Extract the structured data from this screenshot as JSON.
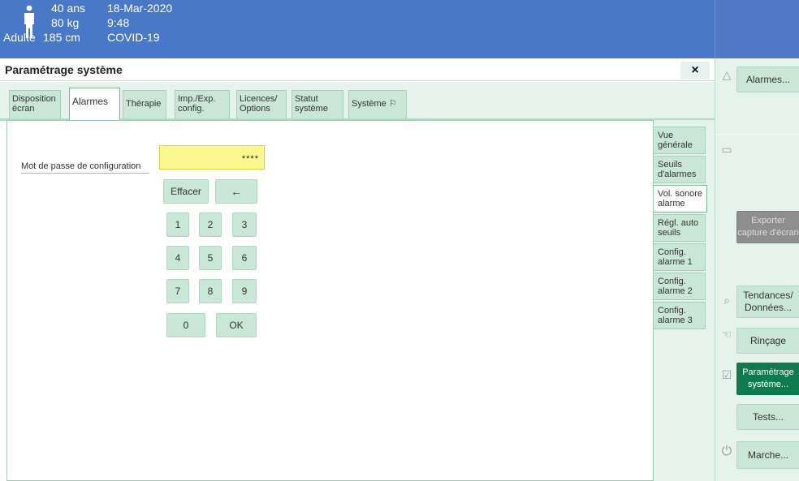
{
  "patient": {
    "age": "40 ans",
    "weight": "80 kg",
    "category": "Adulte",
    "height": "185 cm",
    "date": "18-Mar-2020",
    "time": "9:48",
    "diagnosis": "COVID-19"
  },
  "window": {
    "title": "Paramétrage système",
    "close_label": "×"
  },
  "tabs": [
    {
      "label": "Disposition écran"
    },
    {
      "label": "Alarmes"
    },
    {
      "label": "Thérapie"
    },
    {
      "label": "Imp./Exp. config."
    },
    {
      "label": "Licences/ Options"
    },
    {
      "label": "Statut système"
    },
    {
      "label": "Système",
      "icon": "flag-icon"
    }
  ],
  "form": {
    "password_label": "Mot de passe de configuration",
    "password_value": "****"
  },
  "keypad": {
    "clear": "Effacer",
    "backspace": "←",
    "digits": [
      "1",
      "2",
      "3",
      "4",
      "5",
      "6",
      "7",
      "8",
      "9",
      "0"
    ],
    "ok": "OK"
  },
  "side_tabs": [
    {
      "label": "Vue générale"
    },
    {
      "label": "Seuils d'alarmes"
    },
    {
      "label": "Vol. sonore alarme"
    },
    {
      "label": "Régl. auto seuils"
    },
    {
      "label": "Config. alarme 1"
    },
    {
      "label": "Config. alarme 2"
    },
    {
      "label": "Config. alarme 3"
    }
  ],
  "sidebar": {
    "alarms": "Alarmes...",
    "export": "Exporter capture d'écran",
    "trends": "Tendances/ Données...",
    "rinse": "Rinçage",
    "setup": "Paramétrage système...",
    "tests": "Tests...",
    "power": "Marche..."
  },
  "colors": {
    "header": "#4a78c8",
    "tab_bg": "#c9e6d6",
    "panel_bg": "#e6f2ec",
    "input_bg": "#faf88e",
    "highlight": "#0f7a4e",
    "disabled": "#8e8e8e"
  }
}
